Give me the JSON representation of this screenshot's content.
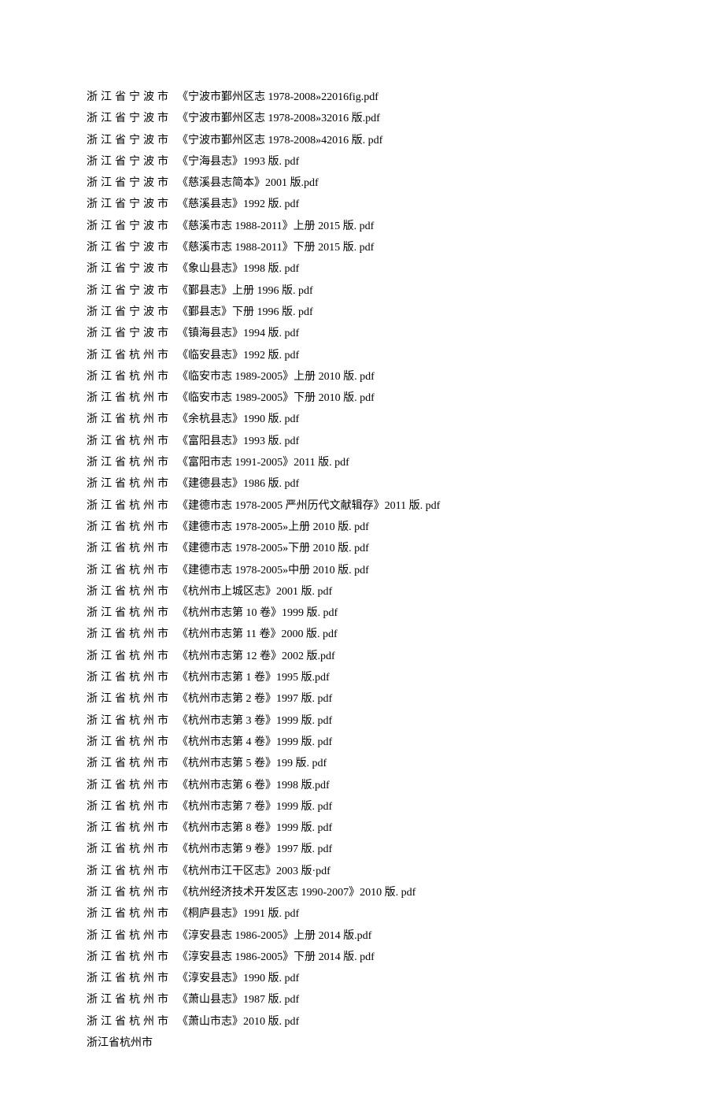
{
  "rows": [
    {
      "region": "浙江省宁波市",
      "tight": false,
      "file": "《宁波市鄞州区志 1978-2008»22016fig.pdf"
    },
    {
      "region": "浙江省宁波市",
      "tight": false,
      "file": "《宁波市鄞州区志 1978-2008»32016 版.pdf"
    },
    {
      "region": "浙江省宁波市",
      "tight": false,
      "file": "《宁波市鄞州区志 1978-2008»42016 版. pdf"
    },
    {
      "region": "浙江省宁波市",
      "tight": false,
      "file": "《宁海县志》1993 版. pdf"
    },
    {
      "region": "浙江省宁波市",
      "tight": false,
      "file": "《慈溪县志简本》2001 版.pdf"
    },
    {
      "region": "浙江省宁波市",
      "tight": false,
      "file": "《慈溪县志》1992 版. pdf"
    },
    {
      "region": "浙江省宁波市",
      "tight": false,
      "file": "《慈溪市志 1988-2011》上册 2015 版. pdf"
    },
    {
      "region": "浙江省宁波市",
      "tight": false,
      "file": "《慈溪市志 1988-2011》下册 2015 版. pdf"
    },
    {
      "region": "浙江省宁波市",
      "tight": false,
      "file": "《象山县志》1998 版. pdf"
    },
    {
      "region": "浙江省宁波市",
      "tight": false,
      "file": "《鄞县志》上册 1996 版. pdf"
    },
    {
      "region": "浙江省宁波市",
      "tight": false,
      "file": "《鄞县志》下册 1996 版. pdf"
    },
    {
      "region": "浙江省宁波市",
      "tight": false,
      "file": "《镇海县志》1994 版. pdf"
    },
    {
      "region": "浙江省杭州市",
      "tight": false,
      "file": "《临安县志》1992 版. pdf"
    },
    {
      "region": "浙江省杭州市",
      "tight": false,
      "file": "《临安市志 1989-2005》上册 2010 版. pdf"
    },
    {
      "region": "浙江省杭州市",
      "tight": false,
      "file": "《临安市志 1989-2005》下册 2010 版. pdf"
    },
    {
      "region": "浙江省杭州市",
      "tight": false,
      "file": "《余杭县志》1990 版. pdf"
    },
    {
      "region": "浙江省杭州市",
      "tight": false,
      "file": "《富阳县志》1993 版. pdf"
    },
    {
      "region": "浙江省杭州市",
      "tight": false,
      "file": "《富阳市志 1991-2005》2011 版. pdf"
    },
    {
      "region": "浙江省杭州市",
      "tight": false,
      "file": "《建德县志》1986 版. pdf"
    },
    {
      "region": "浙江省杭州市",
      "tight": false,
      "file": "《建德市志 1978-2005 严州历代文献辑存》2011 版. pdf"
    },
    {
      "region": "浙江省杭州市",
      "tight": false,
      "file": "《建德市志 1978-2005»上册 2010 版. pdf"
    },
    {
      "region": "浙江省杭州市",
      "tight": false,
      "file": "《建德市志 1978-2005»下册 2010 版. pdf"
    },
    {
      "region": "浙江省杭州市",
      "tight": false,
      "file": "《建德市志 1978-2005»中册 2010 版. pdf"
    },
    {
      "region": "浙江省杭州市",
      "tight": false,
      "file": "《杭州市上城区志》2001 版. pdf"
    },
    {
      "region": "浙江省杭州市",
      "tight": false,
      "file": "《杭州市志第 10 卷》1999 版. pdf"
    },
    {
      "region": "浙江省杭州市",
      "tight": false,
      "file": "《杭州市志第 11 卷》2000 版. pdf"
    },
    {
      "region": "浙江省杭州市",
      "tight": false,
      "file": "《杭州市志第 12 卷》2002 版.pdf"
    },
    {
      "region": "浙江省杭州市",
      "tight": false,
      "file": "《杭州市志第 1 卷》1995 版.pdf"
    },
    {
      "region": "浙江省杭州市",
      "tight": false,
      "file": "《杭州市志第 2 卷》1997 版. pdf"
    },
    {
      "region": "浙江省杭州市",
      "tight": false,
      "file": "《杭州市志第 3 卷》1999 版. pdf"
    },
    {
      "region": "浙江省杭州市",
      "tight": false,
      "file": "《杭州市志第 4 卷》1999 版. pdf"
    },
    {
      "region": "浙江省杭州市",
      "tight": false,
      "file": "《杭州市志第 5 卷》199 版. pdf"
    },
    {
      "region": "浙江省杭州市",
      "tight": false,
      "file": "《杭州市志第 6 卷》1998 版.pdf"
    },
    {
      "region": "浙江省杭州市",
      "tight": false,
      "file": "《杭州市志第 7 卷》1999 版. pdf"
    },
    {
      "region": "浙江省杭州市",
      "tight": false,
      "file": "《杭州市志第 8 卷》1999 版. pdf"
    },
    {
      "region": "浙江省杭州市",
      "tight": false,
      "file": "《杭州市志第 9 卷》1997 版. pdf"
    },
    {
      "region": "浙江省杭州市",
      "tight": false,
      "file": "《杭州市江干区志》2003 版·pdf"
    },
    {
      "region": "浙江省杭州市",
      "tight": false,
      "file": "《杭州经济技术开发区志 1990-2007》2010 版. pdf"
    },
    {
      "region": "浙江省杭州市",
      "tight": false,
      "file": "《桐庐县志》1991 版. pdf"
    },
    {
      "region": "浙江省杭州市",
      "tight": false,
      "file": "《淳安县志 1986-2005》上册 2014 版.pdf"
    },
    {
      "region": "浙江省杭州市",
      "tight": false,
      "file": "《淳安县志 1986-2005》下册 2014 版. pdf"
    },
    {
      "region": "浙江省杭州市",
      "tight": false,
      "file": "《淳安县志》1990 版. pdf"
    },
    {
      "region": "浙江省杭州市",
      "tight": false,
      "file": "《萧山县志》1987 版. pdf"
    },
    {
      "region": "浙江省杭州市",
      "tight": false,
      "file": "《萧山市志》2010 版. pdf"
    },
    {
      "region": "浙江省杭州市",
      "tight": true,
      "file": ""
    }
  ]
}
